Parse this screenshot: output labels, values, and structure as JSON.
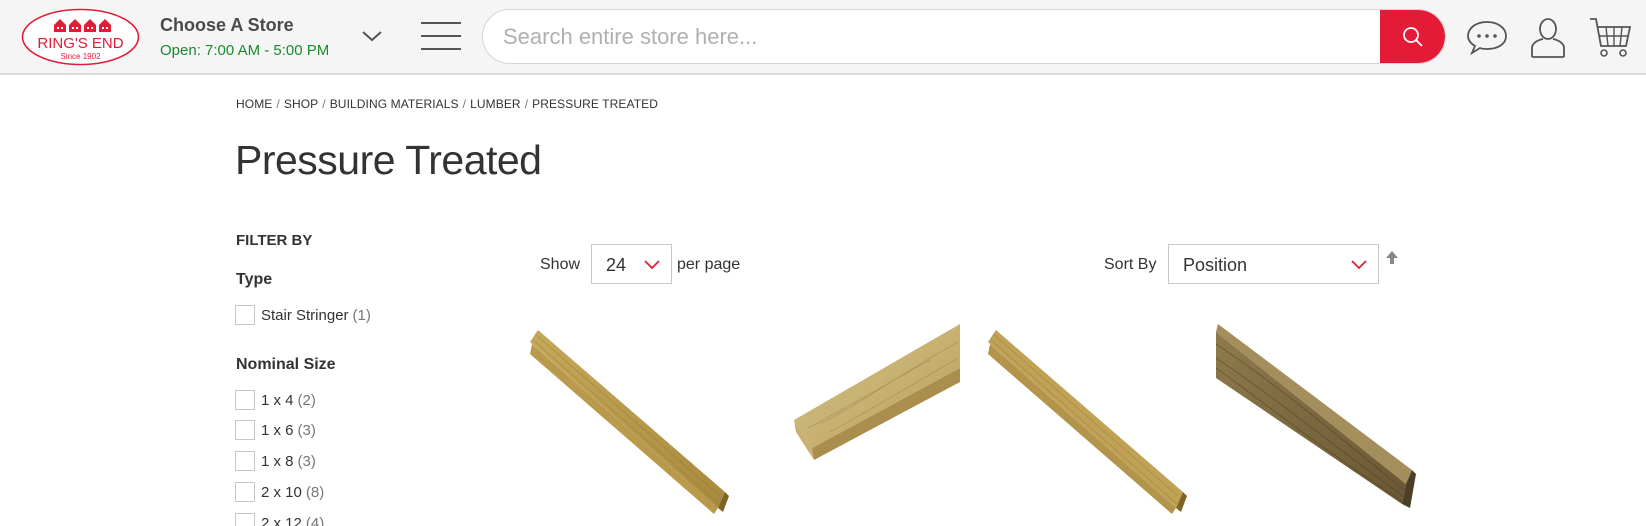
{
  "header": {
    "logo": {
      "name": "RING'S END",
      "tagline": "Since 1902"
    },
    "store": {
      "title": "Choose A Store",
      "hours": "Open: 7:00 AM - 5:00 PM"
    },
    "search": {
      "placeholder": "Search entire store here..."
    },
    "icons": [
      "menu-icon",
      "search-icon",
      "chat-icon",
      "account-icon",
      "cart-icon"
    ],
    "colors": {
      "accent": "#e31b37",
      "hours_green": "#1a8a2e"
    }
  },
  "breadcrumb": [
    "HOME",
    "SHOP",
    "BUILDING MATERIALS",
    "LUMBER",
    "PRESSURE TREATED"
  ],
  "page_title": "Pressure Treated",
  "filters": {
    "heading": "FILTER BY",
    "groups": [
      {
        "title": "Type",
        "options": [
          {
            "label": "Stair Stringer",
            "count": "(1)"
          }
        ]
      },
      {
        "title": "Nominal Size",
        "options": [
          {
            "label": "1 x 4",
            "count": "(2)"
          },
          {
            "label": "1 x 6",
            "count": "(3)"
          },
          {
            "label": "1 x 8",
            "count": "(3)"
          },
          {
            "label": "2 x 10",
            "count": "(8)"
          },
          {
            "label": "2 x 12",
            "count": "(4)"
          }
        ]
      }
    ]
  },
  "toolbar": {
    "show_label": "Show",
    "limit_value": "24",
    "per_page_label": "per page",
    "sort_label": "Sort By",
    "sort_value": "Position"
  }
}
